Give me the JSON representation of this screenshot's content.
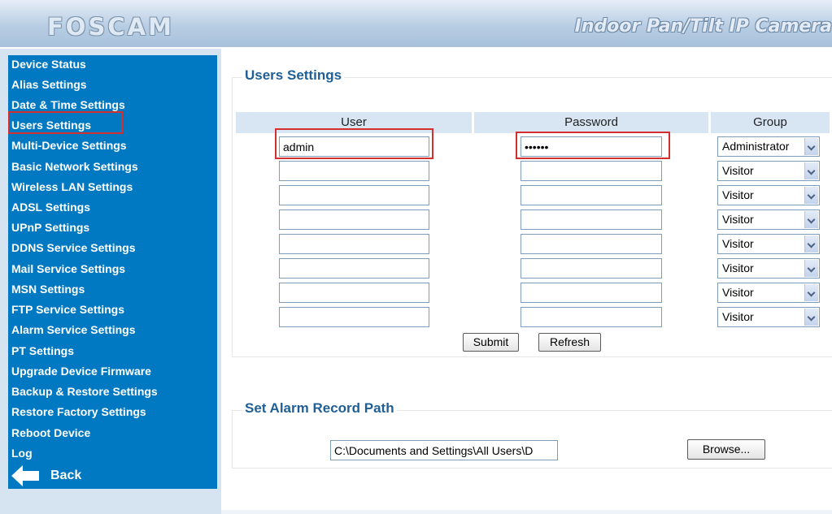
{
  "header": {
    "logo": "FOSCAM",
    "model": "Indoor Pan/Tilt IP Camera"
  },
  "sidebar": {
    "items": [
      {
        "label": "Device Status"
      },
      {
        "label": "Alias Settings"
      },
      {
        "label": "Date & Time Settings"
      },
      {
        "label": "Users Settings"
      },
      {
        "label": "Multi-Device Settings"
      },
      {
        "label": "Basic Network Settings"
      },
      {
        "label": "Wireless LAN Settings"
      },
      {
        "label": "ADSL Settings"
      },
      {
        "label": "UPnP Settings"
      },
      {
        "label": "DDNS Service Settings"
      },
      {
        "label": "Mail Service Settings"
      },
      {
        "label": "MSN Settings"
      },
      {
        "label": "FTP Service Settings"
      },
      {
        "label": "Alarm Service Settings"
      },
      {
        "label": "PT Settings"
      },
      {
        "label": "Upgrade Device Firmware"
      },
      {
        "label": "Backup & Restore Settings"
      },
      {
        "label": "Restore Factory Settings"
      },
      {
        "label": "Reboot Device"
      },
      {
        "label": "Log"
      }
    ],
    "active_item": "Users Settings",
    "back_label": "Back"
  },
  "users": {
    "title": "Users Settings",
    "columns": [
      "User",
      "Password",
      "Group"
    ],
    "rows": [
      {
        "user": "admin",
        "password": "••••••",
        "group": "Administrator"
      },
      {
        "user": "",
        "password": "",
        "group": "Visitor"
      },
      {
        "user": "",
        "password": "",
        "group": "Visitor"
      },
      {
        "user": "",
        "password": "",
        "group": "Visitor"
      },
      {
        "user": "",
        "password": "",
        "group": "Visitor"
      },
      {
        "user": "",
        "password": "",
        "group": "Visitor"
      },
      {
        "user": "",
        "password": "",
        "group": "Visitor"
      },
      {
        "user": "",
        "password": "",
        "group": "Visitor"
      }
    ],
    "submit_label": "Submit",
    "refresh_label": "Refresh"
  },
  "alarm_path": {
    "title": "Set Alarm Record Path",
    "path_value": "C:\\Documents and Settings\\All Users\\D",
    "browse_label": "Browse..."
  },
  "colors": {
    "sidebar_bg": "#0079c2",
    "highlight": "#d32f2f",
    "section_title": "#1f5f95",
    "table_header": "#d8e6f4"
  }
}
